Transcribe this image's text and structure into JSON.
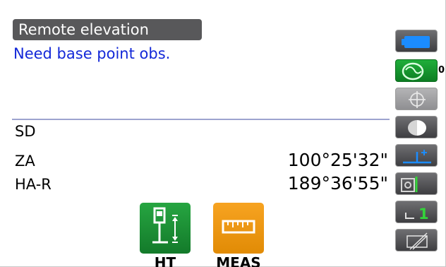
{
  "header": {
    "title": "Remote elevation",
    "message": "Need base point obs."
  },
  "measurements": [
    {
      "label": "SD",
      "value": ""
    },
    {
      "label": "ZA",
      "value": "100°25'32\""
    },
    {
      "label": "HA-R",
      "value": "189°36'55\""
    }
  ],
  "sidebar": {
    "battery_icon": "battery-icon",
    "tilt_icon": "tilt-icon",
    "tilt_value": "0",
    "target_icon": "target-icon",
    "face_icon": "face-icon",
    "instrument_height_icon": "instrument-height-icon",
    "prism_icon": "prism-icon",
    "page_icon": "page-icon",
    "page_number": "1",
    "input_icon": "input-icon"
  },
  "softkeys": {
    "ht_label": "HT",
    "meas_label": "MEAS"
  },
  "colors": {
    "title_bg": "#58585a",
    "message_text": "#1328d8",
    "accent_blue": "#1b8cff",
    "ht_green": "#1f9a39",
    "meas_orange": "#f0990f",
    "page_number_green": "#34d33a"
  }
}
